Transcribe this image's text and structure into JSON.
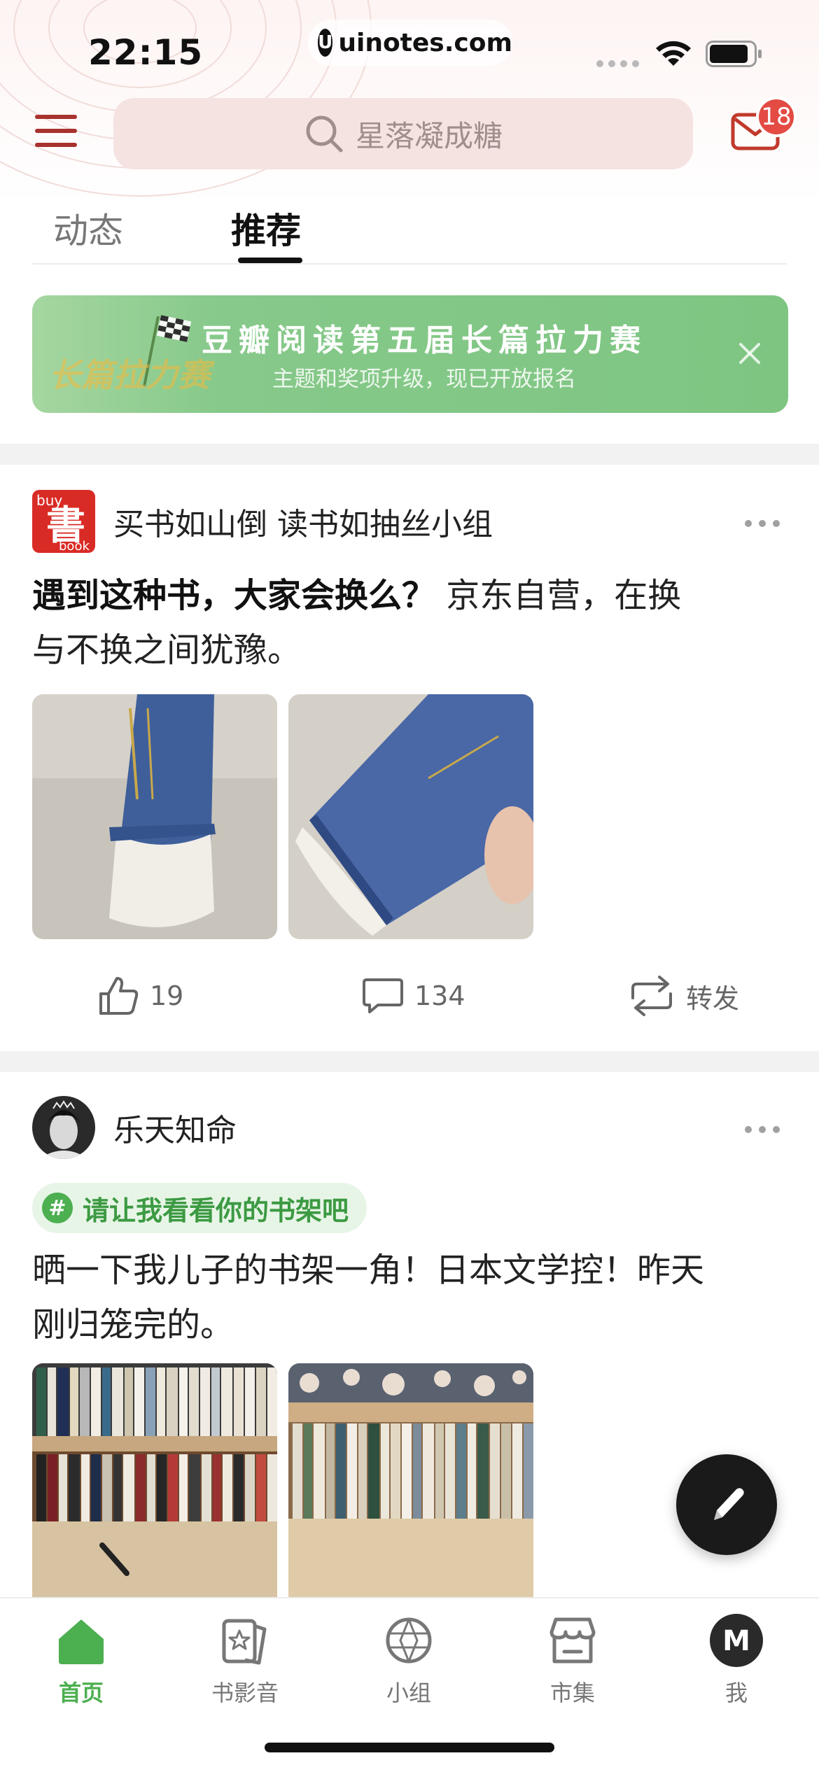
{
  "status_bar": {
    "time": "22:15",
    "url": "uinotes.com",
    "url_logo": "U"
  },
  "header": {
    "search_placeholder": "星落凝成糖",
    "mail_badge": "18"
  },
  "tabs": [
    {
      "label": "动态",
      "active": false
    },
    {
      "label": "推荐",
      "active": true
    }
  ],
  "banner": {
    "title": "豆瓣阅读第五届长篇拉力赛",
    "subtitle": "主题和奖项升级，现已开放报名",
    "art_text": "长篇拉力赛",
    "bg_color": "#86c98a"
  },
  "posts": [
    {
      "author": "买书如山倒 读书如抽丝小组",
      "avatar_text": {
        "top": "buy",
        "main": "書",
        "bottom": "book"
      },
      "title": "遇到这种书，大家会换么？",
      "body_line1": " 京东自营，在换",
      "body_line2": "与不换之间犹豫。",
      "likes": "19",
      "comments": "134",
      "share": "转发"
    },
    {
      "author": "乐天知命",
      "topic": "请让我看看你的书架吧",
      "body_line1": "晒一下我儿子的书架一角！日本文学控！昨天",
      "body_line2": "刚归笼完的。"
    }
  ],
  "bottom_nav": [
    {
      "label": "首页",
      "icon": "home-icon",
      "active": true
    },
    {
      "label": "书影音",
      "icon": "media-icon",
      "active": false
    },
    {
      "label": "小组",
      "icon": "group-icon",
      "active": false
    },
    {
      "label": "市集",
      "icon": "market-icon",
      "active": false
    },
    {
      "label": "我",
      "icon": "profile-icon",
      "active": false,
      "avatar_text": "M"
    }
  ],
  "colors": {
    "accent_green": "#4caf50",
    "brand_red": "#a8322d",
    "badge_red": "#e34b43",
    "search_bg": "#f5e3e1"
  }
}
